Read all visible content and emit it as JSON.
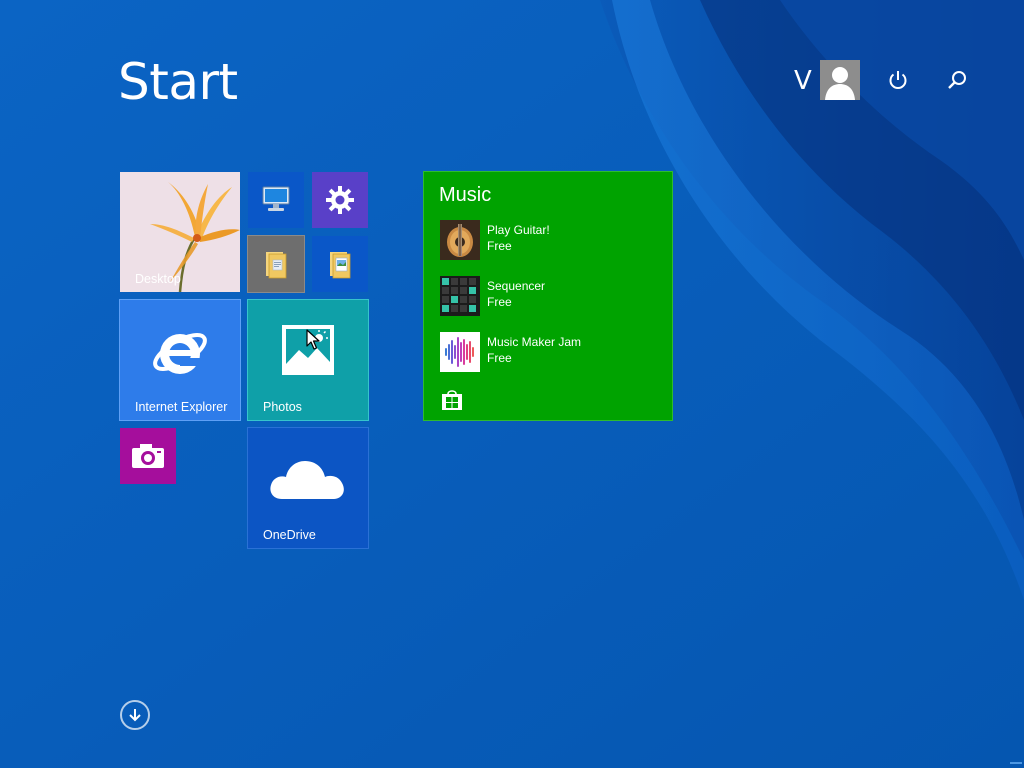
{
  "start": {
    "title": "Start"
  },
  "user": {
    "initial": "V",
    "avatar_icon": "user-avatar-icon",
    "power_icon": "power-icon",
    "search_icon": "search-icon"
  },
  "tiles": {
    "desktop": {
      "label": "Desktop",
      "color": "#e8d6df"
    },
    "this_pc": {
      "icon": "computer-icon",
      "color": "#0a57c8"
    },
    "pc_settings": {
      "icon": "gear-icon",
      "color": "#5940c8"
    },
    "file_explorer": {
      "icon": "folder-icon",
      "color": "#6e6e6e"
    },
    "documents": {
      "icon": "documents-icon",
      "color": "#0a57c8"
    },
    "internet_explorer": {
      "label": "Internet Explorer",
      "color": "#2e7cea"
    },
    "photos": {
      "label": "Photos",
      "color": "#0fa0a8"
    },
    "camera": {
      "icon": "camera-icon",
      "color": "#a50e9c"
    },
    "onedrive": {
      "label": "OneDrive",
      "color": "#0c55c4"
    }
  },
  "music": {
    "title": "Music",
    "color": "#00a300",
    "items": [
      {
        "name": "Play Guitar!",
        "price": "Free",
        "icon": "guitar-icon"
      },
      {
        "name": "Sequencer",
        "price": "Free",
        "icon": "sequencer-icon"
      },
      {
        "name": "Music Maker Jam",
        "price": "Free",
        "icon": "waveform-icon"
      }
    ],
    "store_icon": "store-icon"
  },
  "all_apps_icon": "down-arrow-icon"
}
